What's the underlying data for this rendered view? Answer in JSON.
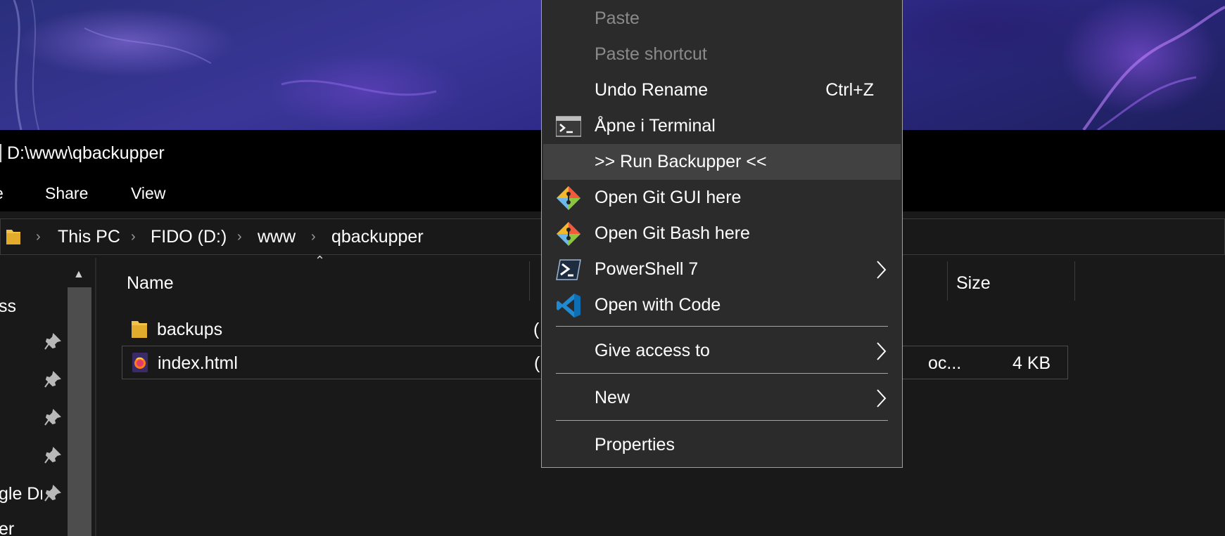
{
  "window": {
    "title": "D:\\www\\qbackupper"
  },
  "ribbon": {
    "tabs": [
      "e",
      "Share",
      "View"
    ]
  },
  "address": {
    "crumbs": [
      "This PC",
      "FIDO (D:)",
      "www",
      "qbackupper"
    ]
  },
  "nav": {
    "items": [
      "ss",
      "gle Dr",
      "er"
    ]
  },
  "columns": {
    "name": "Name",
    "size": "Size"
  },
  "files": [
    {
      "name": "backups",
      "icon": "folder-icon",
      "date_cut": "(",
      "type_cut": "",
      "size": ""
    },
    {
      "name": "index.html",
      "icon": "firefox-html-icon",
      "date_cut": "(",
      "type_cut": "oc...",
      "size": "4 KB"
    }
  ],
  "context_menu": {
    "items": [
      {
        "label": "Paste",
        "disabled": true
      },
      {
        "label": "Paste shortcut",
        "disabled": true
      },
      {
        "label": "Undo Rename",
        "shortcut": "Ctrl+Z"
      },
      {
        "label": "Åpne i Terminal",
        "icon": "terminal-icon"
      },
      {
        "label": ">> Run Backupper <<"
      },
      {
        "label": "Open Git GUI here",
        "icon": "git-icon"
      },
      {
        "label": "Open Git Bash here",
        "icon": "git-icon"
      },
      {
        "label": "PowerShell 7",
        "icon": "powershell-icon",
        "submenu": true
      },
      {
        "label": "Open with Code",
        "icon": "vscode-icon"
      },
      {
        "label": "Give access to",
        "submenu": true
      },
      {
        "label": "New",
        "submenu": true
      },
      {
        "label": "Properties"
      }
    ]
  },
  "colors": {
    "menu_bg": "#2b2b2b",
    "menu_hover": "#414141",
    "explorer_bg": "#191919",
    "folder": "#f0c24a"
  }
}
